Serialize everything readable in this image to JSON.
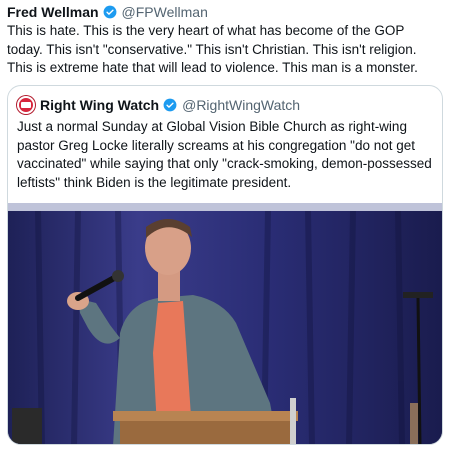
{
  "tweet": {
    "author_name": "Fred Wellman",
    "author_handle": "@FPWellman",
    "text": "This is hate. This is the very heart of what has become of the GOP today. This isn't \"conservative.\" This isn't Christian. This isn't religion. This is extreme hate that will lead to violence. This man is a monster."
  },
  "quoted_tweet": {
    "author_name": "Right Wing Watch",
    "author_handle": "@RightWingWatch",
    "text": "Just a normal Sunday at Global Vision Bible Church as right-wing pastor Greg Locke literally screams at his congregation \"do not get vaccinated\" while saying that only \"crack-smoking, demon-possessed leftists\" think Biden is the legitimate president."
  },
  "icons": {
    "verified": "verified-badge-icon",
    "quote_avatar": "right-wing-watch-logo"
  },
  "colors": {
    "verified_blue": "#1d9bf0",
    "text_primary": "#0f1419",
    "text_secondary": "#536471",
    "border": "#cfd9de",
    "curtain": "#2a2d6e"
  }
}
